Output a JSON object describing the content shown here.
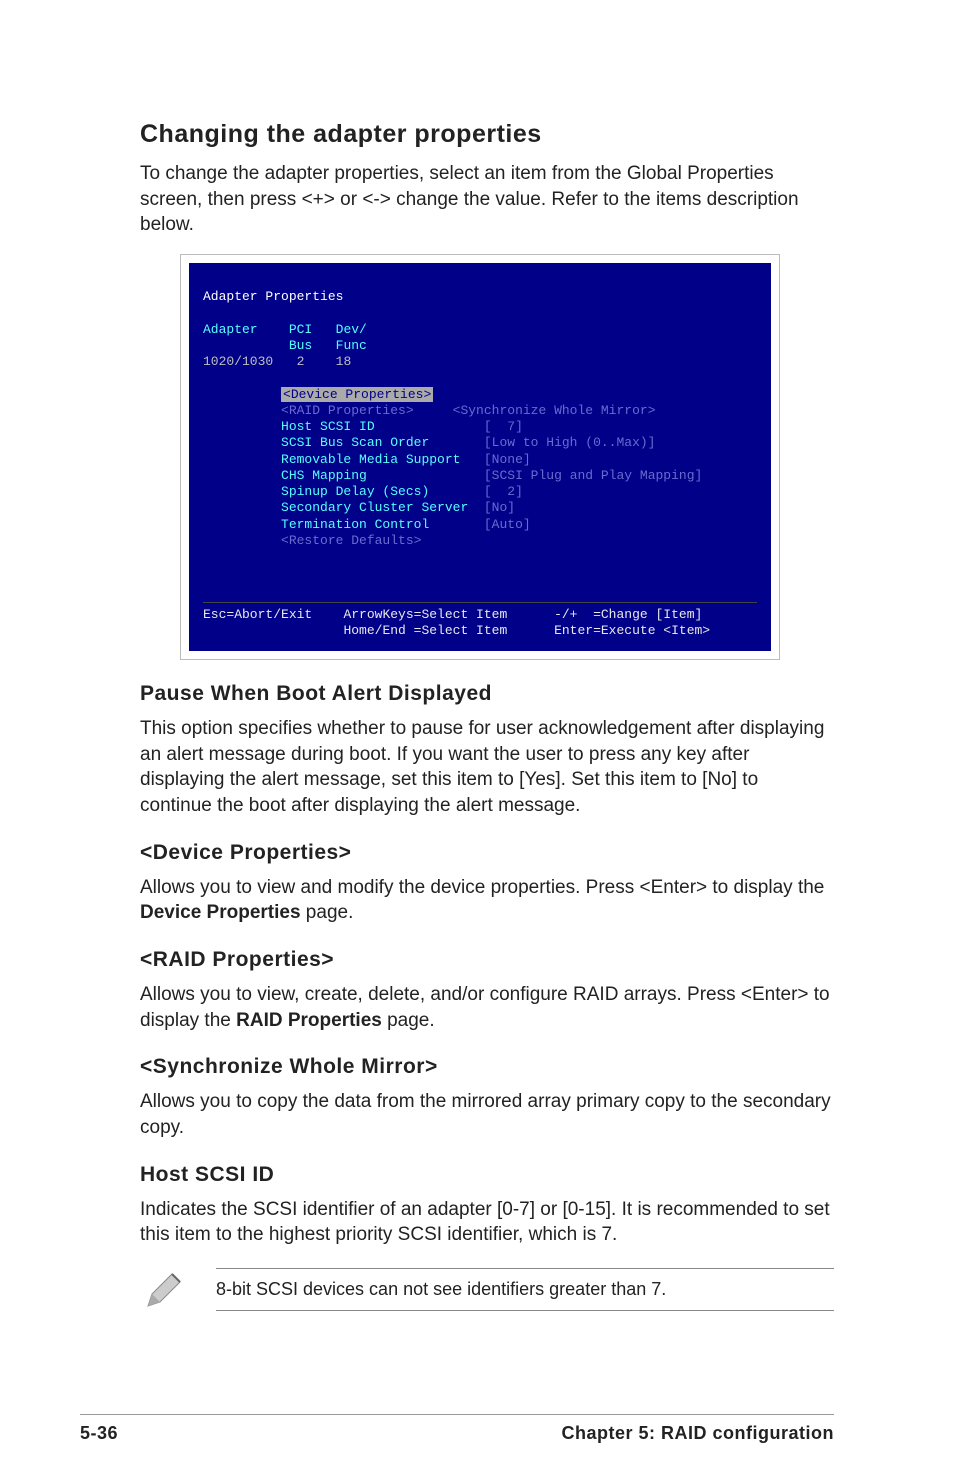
{
  "title": "Changing the adapter properties",
  "intro": "To change the adapter properties, select an item from the Global Properties screen, then press <+> or <-> change the value. Refer to the items description below.",
  "bios": {
    "header": "Adapter Properties",
    "col_adapter": "Adapter",
    "col_pci": "PCI",
    "col_bus": "Bus",
    "col_dev": "Dev/",
    "col_func": "Func",
    "row_adapter": "1020/1030",
    "row_bus": "2",
    "row_func": "18",
    "selected": "<Device Properties>",
    "items": [
      {
        "label": "<RAID Properties>",
        "value": "<Synchronize Whole Mirror>"
      },
      {
        "label": "Host SCSI ID",
        "value": "[  7]"
      },
      {
        "label": "SCSI Bus Scan Order",
        "value": "[Low to High (0..Max)]"
      },
      {
        "label": "Removable Media Support",
        "value": "[None]"
      },
      {
        "label": "CHS Mapping",
        "value": "[SCSI Plug and Play Mapping]"
      },
      {
        "label": "Spinup Delay (Secs)",
        "value": "[  2]"
      },
      {
        "label": "Secondary Cluster Server",
        "value": "[No]"
      },
      {
        "label": "Termination Control",
        "value": "[Auto]"
      },
      {
        "label": "<Restore Defaults>",
        "value": ""
      }
    ],
    "footer_left": "Esc=Abort/Exit",
    "footer_mid1": "ArrowKeys=Select Item",
    "footer_mid2": "Home/End =Select Item",
    "footer_right1": "-/+  =Change [Item]",
    "footer_right2": "Enter=Execute <Item>"
  },
  "sections": {
    "pause": {
      "title": "Pause When Boot Alert Displayed",
      "body": "This option specifies whether to pause for user acknowledgement after displaying an alert message during boot. If you want the user to press any key after displaying the alert message, set this item to [Yes]. Set this item to [No] to continue the boot after displaying the alert message."
    },
    "device": {
      "title": "<Device Properties>",
      "body_pre": "Allows you to view and modify the device properties. Press <Enter> to display the ",
      "body_bold": "Device Properties",
      "body_post": " page."
    },
    "raid": {
      "title": "<RAID Properties>",
      "body_pre": "Allows you to view, create, delete, and/or configure RAID arrays. Press <Enter> to display the ",
      "body_bold": "RAID Properties",
      "body_post": " page."
    },
    "sync": {
      "title": "<Synchronize Whole Mirror>",
      "body": "Allows you to copy the data from the mirrored array primary copy to the secondary copy."
    },
    "host": {
      "title": "Host SCSI ID",
      "body": "Indicates the SCSI identifier of an adapter [0-7] or [0-15]. It is recommended to set this item to the highest priority SCSI identifier, which is 7."
    }
  },
  "note": "8-bit SCSI devices can not see identifiers greater than 7.",
  "footer": {
    "left": "5-36",
    "right": "Chapter 5: RAID configuration"
  }
}
